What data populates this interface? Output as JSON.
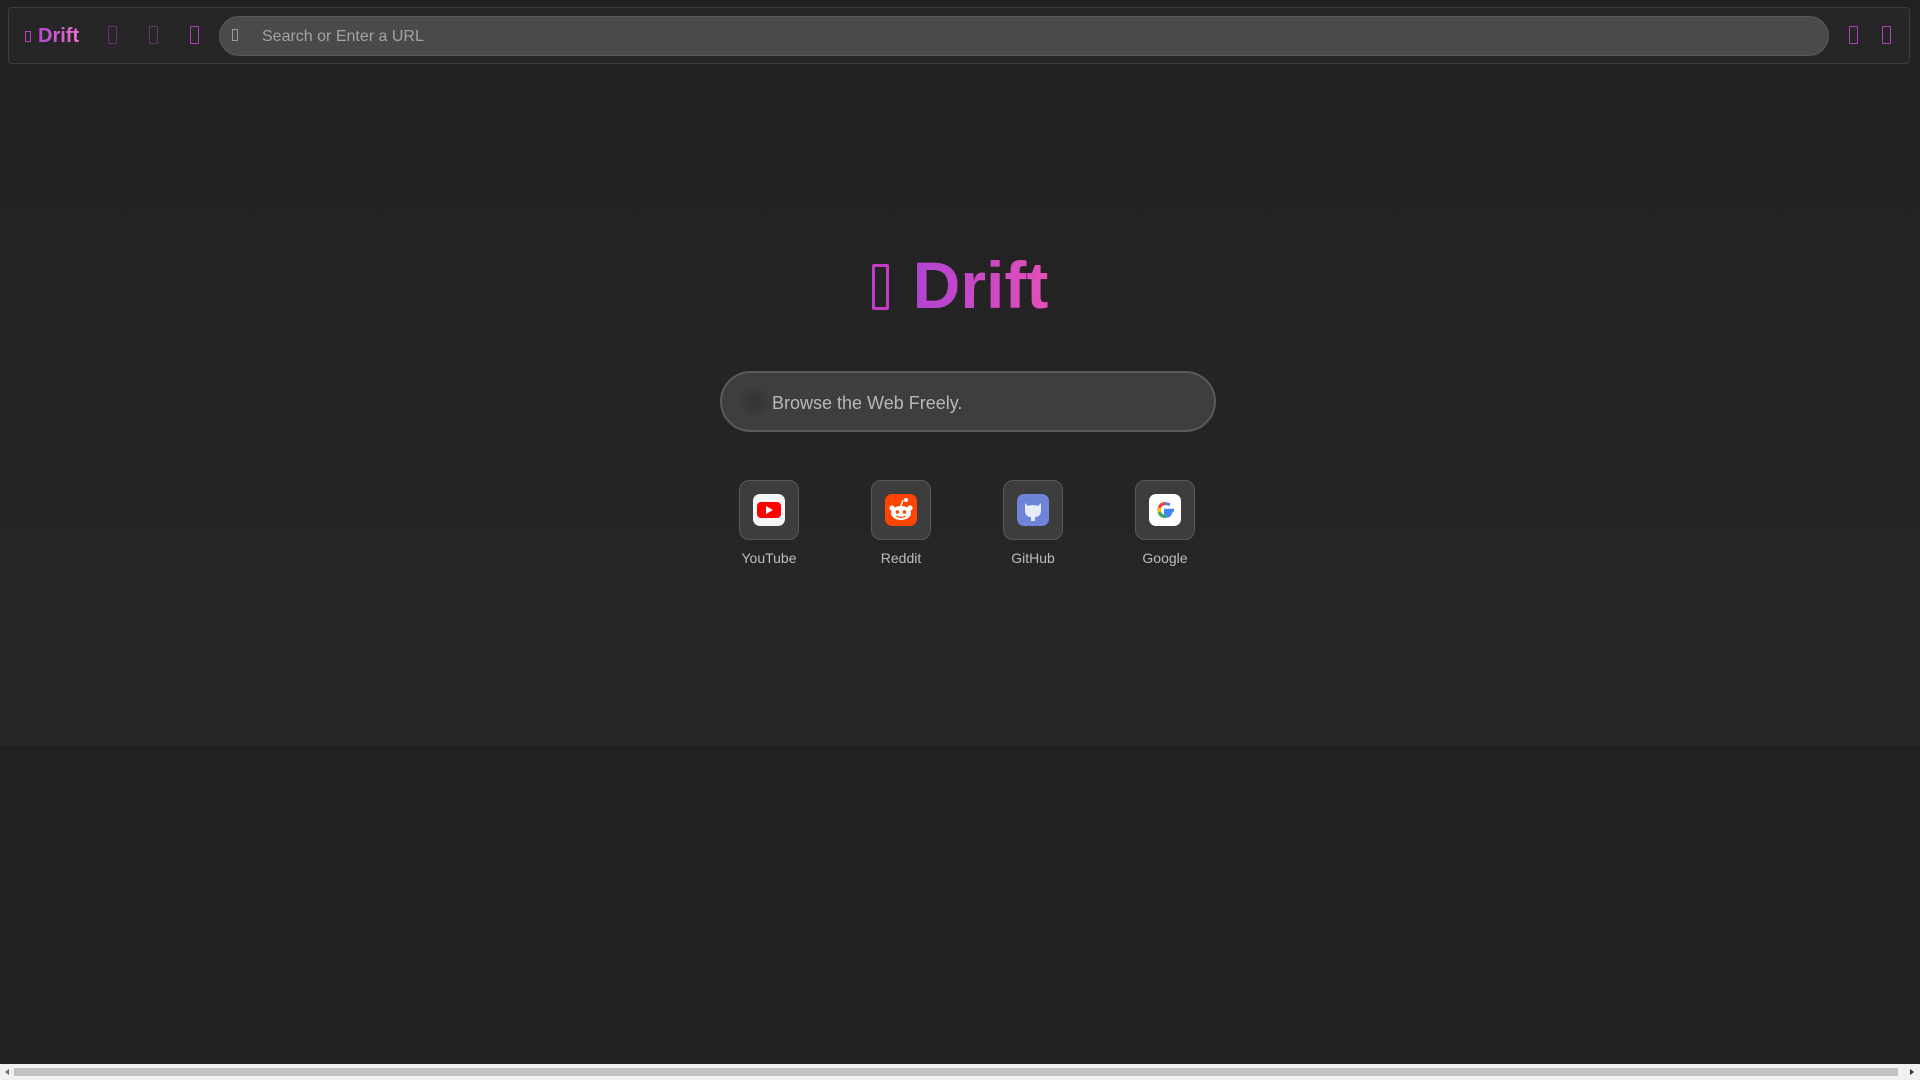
{
  "toolbar": {
    "brand_icon": "brand-glyph-icon",
    "brand_name": "Drift",
    "buttons": [
      {
        "name": "back-button",
        "icon": "back-arrow-icon"
      },
      {
        "name": "forward-button",
        "icon": "forward-arrow-icon"
      },
      {
        "name": "reload-button",
        "icon": "reload-icon"
      }
    ],
    "address_icon": "search-icon",
    "address_placeholder": "Search or Enter a URL",
    "right_buttons": [
      {
        "name": "fullscreen-button",
        "icon": "fullscreen-icon"
      },
      {
        "name": "settings-button",
        "icon": "settings-icon"
      }
    ]
  },
  "hero": {
    "icon": "brand-glyph-icon",
    "title": "Drift"
  },
  "search": {
    "placeholder": "Browse the Web Freely."
  },
  "shortcuts": [
    {
      "label": "YouTube",
      "icon": "youtube-icon",
      "color": "#ff0000"
    },
    {
      "label": "Reddit",
      "icon": "reddit-icon",
      "color": "#ff4500"
    },
    {
      "label": "GitHub",
      "icon": "github-icon",
      "color": "#7289da"
    },
    {
      "label": "Google",
      "icon": "google-icon",
      "color": "#4285f4"
    }
  ],
  "colors": {
    "accent": "#c23cc8",
    "background": "#212121"
  }
}
